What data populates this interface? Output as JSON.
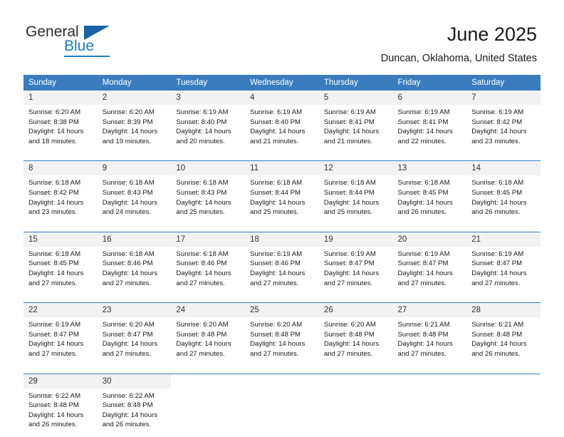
{
  "brand": {
    "name_part1": "General",
    "name_part2": "Blue",
    "accent_color": "#1b7cc2",
    "flag_color": "#1763a5"
  },
  "header": {
    "title": "June 2025",
    "subtitle": "Duncan, Oklahoma, United States"
  },
  "theme": {
    "header_bg": "#3a7dbf",
    "daynum_bg": "#f2f2f2",
    "grid_line": "#3a7dbf"
  },
  "calendar": {
    "weekday_headers": [
      "Sunday",
      "Monday",
      "Tuesday",
      "Wednesday",
      "Thursday",
      "Friday",
      "Saturday"
    ],
    "weeks": [
      [
        {
          "day": "1",
          "sunrise": "Sunrise: 6:20 AM",
          "sunset": "Sunset: 8:38 PM",
          "daylight_line1": "Daylight: 14 hours",
          "daylight_line2": "and 18 minutes."
        },
        {
          "day": "2",
          "sunrise": "Sunrise: 6:20 AM",
          "sunset": "Sunset: 8:39 PM",
          "daylight_line1": "Daylight: 14 hours",
          "daylight_line2": "and 19 minutes."
        },
        {
          "day": "3",
          "sunrise": "Sunrise: 6:19 AM",
          "sunset": "Sunset: 8:40 PM",
          "daylight_line1": "Daylight: 14 hours",
          "daylight_line2": "and 20 minutes."
        },
        {
          "day": "4",
          "sunrise": "Sunrise: 6:19 AM",
          "sunset": "Sunset: 8:40 PM",
          "daylight_line1": "Daylight: 14 hours",
          "daylight_line2": "and 21 minutes."
        },
        {
          "day": "5",
          "sunrise": "Sunrise: 6:19 AM",
          "sunset": "Sunset: 8:41 PM",
          "daylight_line1": "Daylight: 14 hours",
          "daylight_line2": "and 21 minutes."
        },
        {
          "day": "6",
          "sunrise": "Sunrise: 6:19 AM",
          "sunset": "Sunset: 8:41 PM",
          "daylight_line1": "Daylight: 14 hours",
          "daylight_line2": "and 22 minutes."
        },
        {
          "day": "7",
          "sunrise": "Sunrise: 6:19 AM",
          "sunset": "Sunset: 8:42 PM",
          "daylight_line1": "Daylight: 14 hours",
          "daylight_line2": "and 23 minutes."
        }
      ],
      [
        {
          "day": "8",
          "sunrise": "Sunrise: 6:18 AM",
          "sunset": "Sunset: 8:42 PM",
          "daylight_line1": "Daylight: 14 hours",
          "daylight_line2": "and 23 minutes."
        },
        {
          "day": "9",
          "sunrise": "Sunrise: 6:18 AM",
          "sunset": "Sunset: 8:43 PM",
          "daylight_line1": "Daylight: 14 hours",
          "daylight_line2": "and 24 minutes."
        },
        {
          "day": "10",
          "sunrise": "Sunrise: 6:18 AM",
          "sunset": "Sunset: 8:43 PM",
          "daylight_line1": "Daylight: 14 hours",
          "daylight_line2": "and 25 minutes."
        },
        {
          "day": "11",
          "sunrise": "Sunrise: 6:18 AM",
          "sunset": "Sunset: 8:44 PM",
          "daylight_line1": "Daylight: 14 hours",
          "daylight_line2": "and 25 minutes."
        },
        {
          "day": "12",
          "sunrise": "Sunrise: 6:18 AM",
          "sunset": "Sunset: 8:44 PM",
          "daylight_line1": "Daylight: 14 hours",
          "daylight_line2": "and 25 minutes."
        },
        {
          "day": "13",
          "sunrise": "Sunrise: 6:18 AM",
          "sunset": "Sunset: 8:45 PM",
          "daylight_line1": "Daylight: 14 hours",
          "daylight_line2": "and 26 minutes."
        },
        {
          "day": "14",
          "sunrise": "Sunrise: 6:18 AM",
          "sunset": "Sunset: 8:45 PM",
          "daylight_line1": "Daylight: 14 hours",
          "daylight_line2": "and 26 minutes."
        }
      ],
      [
        {
          "day": "15",
          "sunrise": "Sunrise: 6:18 AM",
          "sunset": "Sunset: 8:45 PM",
          "daylight_line1": "Daylight: 14 hours",
          "daylight_line2": "and 27 minutes."
        },
        {
          "day": "16",
          "sunrise": "Sunrise: 6:18 AM",
          "sunset": "Sunset: 8:46 PM",
          "daylight_line1": "Daylight: 14 hours",
          "daylight_line2": "and 27 minutes."
        },
        {
          "day": "17",
          "sunrise": "Sunrise: 6:18 AM",
          "sunset": "Sunset: 8:46 PM",
          "daylight_line1": "Daylight: 14 hours",
          "daylight_line2": "and 27 minutes."
        },
        {
          "day": "18",
          "sunrise": "Sunrise: 6:19 AM",
          "sunset": "Sunset: 8:46 PM",
          "daylight_line1": "Daylight: 14 hours",
          "daylight_line2": "and 27 minutes."
        },
        {
          "day": "19",
          "sunrise": "Sunrise: 6:19 AM",
          "sunset": "Sunset: 8:47 PM",
          "daylight_line1": "Daylight: 14 hours",
          "daylight_line2": "and 27 minutes."
        },
        {
          "day": "20",
          "sunrise": "Sunrise: 6:19 AM",
          "sunset": "Sunset: 8:47 PM",
          "daylight_line1": "Daylight: 14 hours",
          "daylight_line2": "and 27 minutes."
        },
        {
          "day": "21",
          "sunrise": "Sunrise: 6:19 AM",
          "sunset": "Sunset: 8:47 PM",
          "daylight_line1": "Daylight: 14 hours",
          "daylight_line2": "and 27 minutes."
        }
      ],
      [
        {
          "day": "22",
          "sunrise": "Sunrise: 6:19 AM",
          "sunset": "Sunset: 8:47 PM",
          "daylight_line1": "Daylight: 14 hours",
          "daylight_line2": "and 27 minutes."
        },
        {
          "day": "23",
          "sunrise": "Sunrise: 6:20 AM",
          "sunset": "Sunset: 8:47 PM",
          "daylight_line1": "Daylight: 14 hours",
          "daylight_line2": "and 27 minutes."
        },
        {
          "day": "24",
          "sunrise": "Sunrise: 6:20 AM",
          "sunset": "Sunset: 8:48 PM",
          "daylight_line1": "Daylight: 14 hours",
          "daylight_line2": "and 27 minutes."
        },
        {
          "day": "25",
          "sunrise": "Sunrise: 6:20 AM",
          "sunset": "Sunset: 8:48 PM",
          "daylight_line1": "Daylight: 14 hours",
          "daylight_line2": "and 27 minutes."
        },
        {
          "day": "26",
          "sunrise": "Sunrise: 6:20 AM",
          "sunset": "Sunset: 8:48 PM",
          "daylight_line1": "Daylight: 14 hours",
          "daylight_line2": "and 27 minutes."
        },
        {
          "day": "27",
          "sunrise": "Sunrise: 6:21 AM",
          "sunset": "Sunset: 8:48 PM",
          "daylight_line1": "Daylight: 14 hours",
          "daylight_line2": "and 27 minutes."
        },
        {
          "day": "28",
          "sunrise": "Sunrise: 6:21 AM",
          "sunset": "Sunset: 8:48 PM",
          "daylight_line1": "Daylight: 14 hours",
          "daylight_line2": "and 26 minutes."
        }
      ],
      [
        {
          "day": "29",
          "sunrise": "Sunrise: 6:22 AM",
          "sunset": "Sunset: 8:48 PM",
          "daylight_line1": "Daylight: 14 hours",
          "daylight_line2": "and 26 minutes."
        },
        {
          "day": "30",
          "sunrise": "Sunrise: 6:22 AM",
          "sunset": "Sunset: 8:48 PM",
          "daylight_line1": "Daylight: 14 hours",
          "daylight_line2": "and 26 minutes."
        },
        {
          "day": "",
          "sunrise": "",
          "sunset": "",
          "daylight_line1": "",
          "daylight_line2": ""
        },
        {
          "day": "",
          "sunrise": "",
          "sunset": "",
          "daylight_line1": "",
          "daylight_line2": ""
        },
        {
          "day": "",
          "sunrise": "",
          "sunset": "",
          "daylight_line1": "",
          "daylight_line2": ""
        },
        {
          "day": "",
          "sunrise": "",
          "sunset": "",
          "daylight_line1": "",
          "daylight_line2": ""
        },
        {
          "day": "",
          "sunrise": "",
          "sunset": "",
          "daylight_line1": "",
          "daylight_line2": ""
        }
      ]
    ]
  }
}
